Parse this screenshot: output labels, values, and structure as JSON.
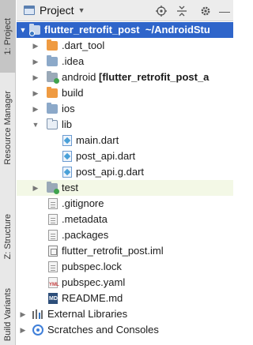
{
  "side_tabs": {
    "project": "1: Project",
    "resource_manager": "Resource Manager",
    "structure": "Z: Structure",
    "build_variants": "Build Variants"
  },
  "header": {
    "title": "Project",
    "caret_icon": "chevron-down-icon",
    "tools": [
      "locate-icon",
      "collapse-all-icon",
      "gear-icon",
      "minimize-icon"
    ]
  },
  "tree": {
    "root": {
      "name": "flutter_retrofit_post",
      "path": "~/AndroidStu"
    },
    "items": [
      {
        "label": ".dart_tool"
      },
      {
        "label": ".idea"
      },
      {
        "label": "android",
        "suffix": "[flutter_retrofit_post_a"
      },
      {
        "label": "build"
      },
      {
        "label": "ios"
      },
      {
        "label": "lib"
      },
      {
        "label": "main.dart"
      },
      {
        "label": "post_api.dart"
      },
      {
        "label": "post_api.g.dart"
      },
      {
        "label": "test"
      },
      {
        "label": ".gitignore"
      },
      {
        "label": ".metadata"
      },
      {
        "label": ".packages"
      },
      {
        "label": "flutter_retrofit_post.iml"
      },
      {
        "label": "pubspec.lock"
      },
      {
        "label": "pubspec.yaml"
      },
      {
        "label": "README.md"
      },
      {
        "label": "External Libraries"
      },
      {
        "label": "Scratches and Consoles"
      }
    ]
  },
  "icon_labels": {
    "yaml": "YML",
    "markdown": "MD"
  },
  "colors": {
    "selection": "#2f65ca",
    "highlight": "#f3f8e6",
    "build_folder": "#ef9b42"
  }
}
